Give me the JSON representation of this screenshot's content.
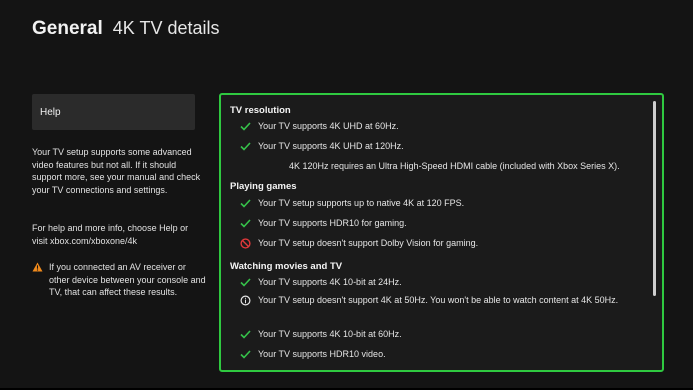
{
  "header": {
    "section": "General",
    "page": "4K TV details"
  },
  "help": {
    "button_label": "Help",
    "paragraph1": "Your TV setup supports some advanced video features but not all. If it should support more, see your manual and check your TV connections and settings.",
    "paragraph2": "For help and more info, choose Help or visit xbox.com/xboxone/4k",
    "warning": "If you connected an AV receiver or other device between your console and TV, that can affect these results."
  },
  "details": {
    "tv_resolution": {
      "title": "TV resolution",
      "items": [
        {
          "status": "check",
          "text": "Your TV supports 4K UHD at 60Hz."
        },
        {
          "status": "check",
          "text": "Your TV supports 4K UHD at 120Hz."
        }
      ],
      "note": "4K 120Hz requires an Ultra High-Speed HDMI cable (included with Xbox Series X)."
    },
    "playing_games": {
      "title": "Playing games",
      "items": [
        {
          "status": "check",
          "text": "Your TV setup supports up to native 4K at 120 FPS."
        },
        {
          "status": "check",
          "text": "Your TV supports HDR10 for gaming."
        },
        {
          "status": "blocked",
          "text": "Your TV setup doesn't support Dolby Vision for gaming."
        }
      ]
    },
    "watching_movies": {
      "title": "Watching movies and TV",
      "items": [
        {
          "status": "check",
          "text": "Your TV supports 4K 10-bit at 24Hz."
        },
        {
          "status": "info",
          "text": "Your TV setup doesn't support 4K at 50Hz. You won't be able to watch content at 4K 50Hz."
        },
        {
          "status": "check",
          "text": "Your TV supports 4K 10-bit at 60Hz."
        },
        {
          "status": "check",
          "text": "Your TV supports HDR10 video."
        }
      ]
    }
  },
  "colors": {
    "accent_green": "#2fc940",
    "check_green": "#36c24a",
    "blocked_red": "#e0383a",
    "warning_orange": "#f08a1c"
  },
  "icons": {
    "check": "check-icon",
    "blocked": "blocked-icon",
    "info": "info-icon",
    "warning": "warning-icon"
  }
}
